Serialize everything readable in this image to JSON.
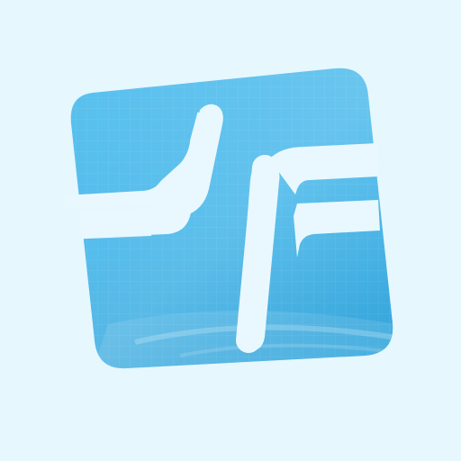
{
  "icon": {
    "name": "app-logo-icon",
    "colors": {
      "background": "#e6f7fe",
      "tile_light": "#62c4ef",
      "tile_mid": "#3db3e8",
      "tile_dark": "#2a9fd8",
      "stroke": "#e9f8fe"
    }
  }
}
